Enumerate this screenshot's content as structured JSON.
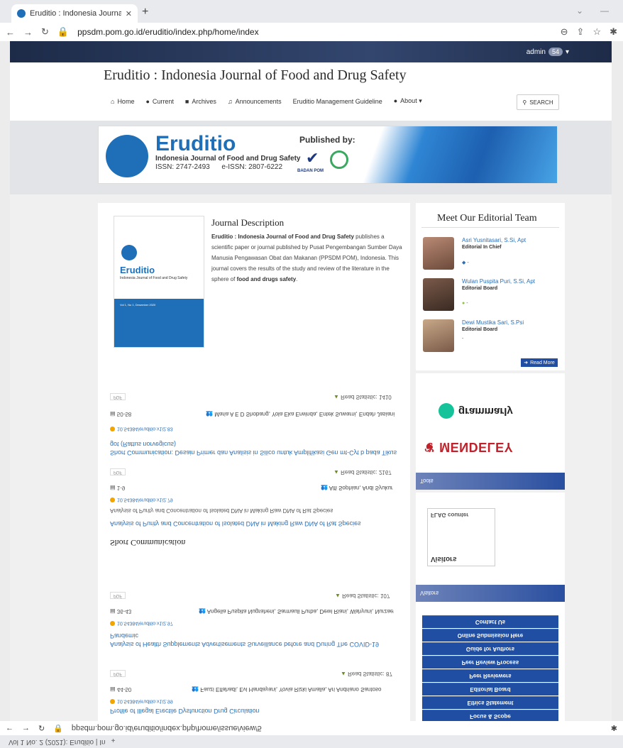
{
  "browser": {
    "tab_title": "Eruditio : Indonesia Journal of Fo",
    "url": "ppsdm.pom.go.id/eruditio/index.php/home/index",
    "bottom_url": "ppsdm.pom.go.id/eruditio/index.php/home/issue/view/5",
    "bottom_tab": "Vol 1 No. 2 (2021): Eruditio | In"
  },
  "admin": {
    "label": "admin",
    "count": "54"
  },
  "site": {
    "title": "Eruditio : Indonesia Journal of Food and Drug Safety"
  },
  "nav": {
    "items": [
      "Home",
      "Current",
      "Archives",
      "Announcements",
      "Eruditio Management Guideline",
      "About"
    ],
    "search": "SEARCH"
  },
  "banner": {
    "name": "Eruditio",
    "subtitle": "Indonesia Journal of Food and Drug Safety",
    "issn": "ISSN: 2747-2493      e-ISSN: 2807-6222",
    "published_by": "Published by:",
    "bpom": "BADAN POM"
  },
  "cover": {
    "name": "Eruditio",
    "subtitle": "Indonesia Journal of Food and Drug Safety",
    "vol": "Vol 1, No 1, Desember 2020"
  },
  "description": {
    "title": "Journal Description",
    "lead": "Eruditio : Indonesia Journal of Food and Drug Safety",
    "body": " publishes a scientific paper or journal published by Pusat Pengembangan Sumber Daya Manusia Pengawasan Obat dan Makanan (PPSDM POM), Indonesia. This journal covers the results of the study and review of the literature in the sphere of ",
    "tail": "food and drugs safety",
    "end": "."
  },
  "editorial": {
    "title": "Meet Our Editorial Team",
    "members": [
      {
        "name": "Asri Yusnitasari, S.Si, Apt",
        "role": "Editorial In Chief"
      },
      {
        "name": "Wulan Puspita Puri, S.Si, Apt",
        "role": "Editorial Board"
      },
      {
        "name": "Dewi Mustika Sari, S.Psi",
        "role": "Editorial Board"
      }
    ],
    "dash": "-",
    "read_more": "Read More"
  },
  "articles": [
    {
      "title": "Short Communication: Desain Primer dan Analisis in Silico untuk Amplifikasi Gen mt-Cyt b pada Tikus got (Rattus norvegicus)",
      "doi": "10.54384/eruditio.v1i2.83",
      "pages": "50-58",
      "authors": "Maria A E D Shobang, Yola Eka Erwinda, Entek Suwarni, Endah Jasiani",
      "pdf": "PDF",
      "stat": "Read Statistic: 1410"
    },
    {
      "title": "Analysis of Purity and Concentration of Isolated DNA in Making Raw DNA of Rat Species",
      "subtitle": "Analysis of Purity and Concentration of Isolated DNA in Making Raw DNA of Rat Species",
      "doi": "10.54384/eruditio.v1i2.79",
      "pages": "1-9",
      "authors": "Alfi Sophian, Andi Syukur",
      "pdf": "PDF",
      "stat": "Read Statistic: 2167"
    },
    {
      "title": "Analysis of Health Supplements Advertisements Surveillance before and During The COVID-19 Pandemic",
      "doi": "10.54384/eruditio.v1i2.97",
      "pages": "36-43",
      "authors": "Angelia Puspita Nugraheni, Sarmauli Purba, Dewi Riani, Wahyuni, Nurzaeti",
      "pdf": "PDF",
      "stat": "Read Statistic: 107"
    },
    {
      "title": "Profile of Illegal Erectile Dysfunction Drug Circulation",
      "doi": "10.54384/eruditio.v1i2.99",
      "pages": "44-50",
      "authors": "Fauzi Elfahadi, Evi Handayani, Yovia Rizki Amalia, Ari Andriano Santoso",
      "pdf": "PDF",
      "stat": "Read Statistic: 87"
    }
  ],
  "section": {
    "short_comm": "Short Communication"
  },
  "sidebar": {
    "mendeley": "MENDELEY",
    "grammarly": "grammarly",
    "tools": "Tools",
    "visitors": "Visitors",
    "flag_counter": "FLAG counter",
    "links": [
      "Focus & Scope",
      "Ethics Statement",
      "Editorial Board",
      "Peer Reviewers",
      "Peer Review Process",
      "Guide for Authors",
      "Online Submission Here",
      "Contact Us"
    ]
  }
}
